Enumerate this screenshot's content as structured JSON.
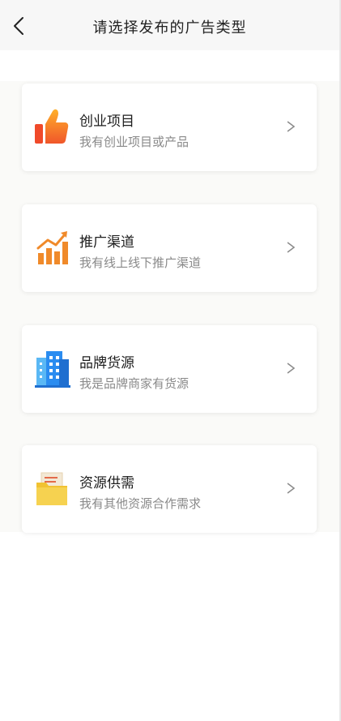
{
  "header": {
    "title": "请选择发布的广告类型",
    "back_icon": "back-arrow-icon"
  },
  "cards": [
    {
      "title": "创业项目",
      "subtitle": "我有创业项目或产品",
      "icon": "thumbs-up-icon",
      "chevron": ">"
    },
    {
      "title": "推广渠道",
      "subtitle": "我有线上线下推广渠道",
      "icon": "growth-chart-icon",
      "chevron": ">"
    },
    {
      "title": "品牌货源",
      "subtitle": "我是品牌商家有货源",
      "icon": "building-icon",
      "chevron": ">"
    },
    {
      "title": "资源供需",
      "subtitle": "我有其他资源合作需求",
      "icon": "folder-icon",
      "chevron": ">"
    }
  ],
  "colors": {
    "header_bg": "#f7f7f7",
    "content_bg": "#fafaf8",
    "title_text": "#222222",
    "card_title": "#1e1e1e",
    "card_subtitle": "#8a8a8a",
    "orange": "#f08a2a",
    "blue": "#2a8cf0",
    "folder_yellow": "#f1c232"
  }
}
